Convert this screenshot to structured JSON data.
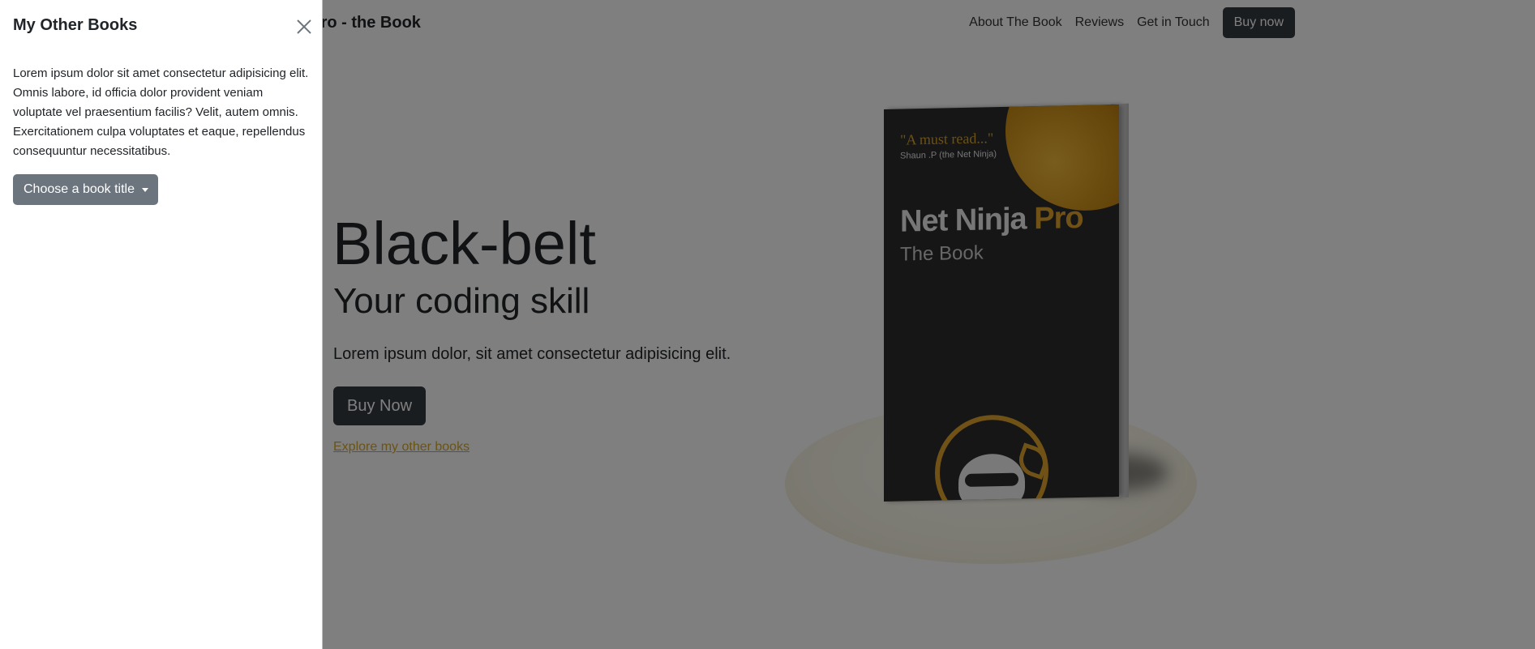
{
  "navbar": {
    "brand": "Net Ninja Pro - the Book",
    "links": [
      "About The Book",
      "Reviews",
      "Get in Touch"
    ],
    "buy_button": "Buy now"
  },
  "hero": {
    "title": "Black-belt",
    "subtitle": "Your coding skill",
    "lead": "Lorem ipsum dolor, sit amet consectetur adipisicing elit.",
    "buy_button": "Buy Now",
    "explore_link": "Explore my other books"
  },
  "book_cover": {
    "quote": "\"A must read...\"",
    "quote_author": "Shaun .P (the Net Ninja)",
    "title_main": "Net Ninja ",
    "title_accent": "Pro",
    "subtitle": "The Book"
  },
  "offcanvas": {
    "title": "My Other Books",
    "body": "Lorem ipsum dolor sit amet consectetur adipisicing elit. Omnis labore, id officia dolor provident veniam voluptate vel praesentium facilis? Velit, autem omnis. Exercitationem culpa voluptates et eaque, repellendus consequuntur necessitatibus.",
    "dropdown_label": "Choose a book title"
  },
  "colors": {
    "accent_gold": "#d4a72c",
    "dark_button": "#343a40",
    "secondary_button": "#6c757d",
    "backdrop": "rgba(0,0,0,0.5)"
  },
  "icons": {
    "close": "close-icon",
    "dropdown": "chevron-down-icon"
  }
}
